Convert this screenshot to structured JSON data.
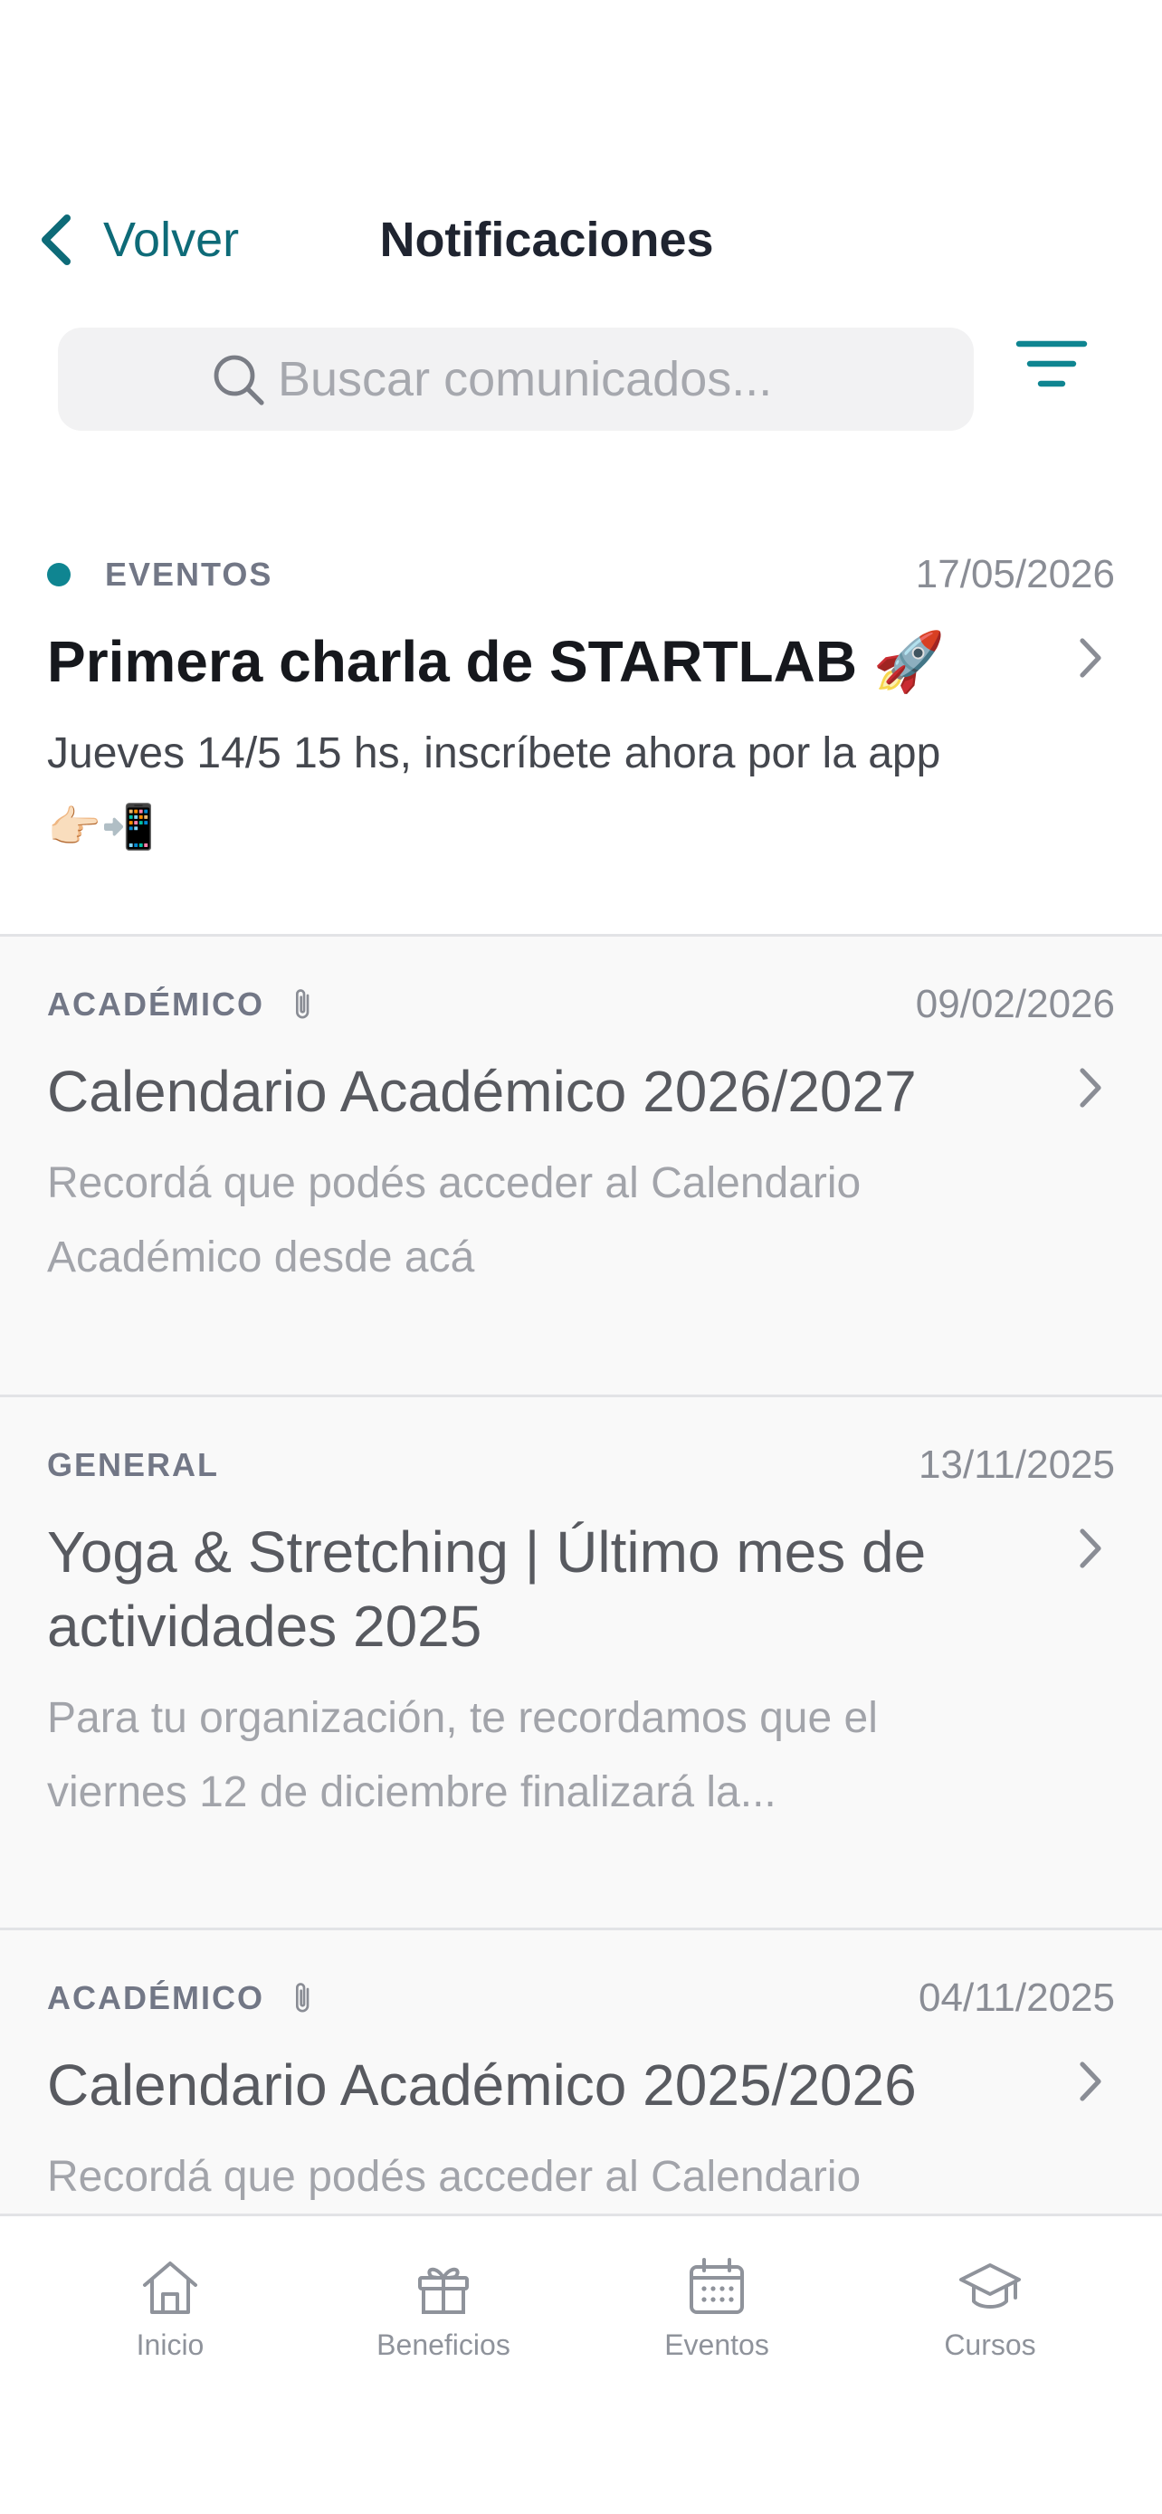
{
  "header": {
    "back_label": "Volver",
    "title": "Notificaciones"
  },
  "search": {
    "placeholder": "Buscar comunicados..."
  },
  "notifications": [
    {
      "category": "EVENTOS",
      "date": "17/05/2026",
      "title": "Primera charla de STARTLAB 🚀",
      "body": "Jueves 14/5 15 hs, inscríbete ahora por la app 👉🏻📲",
      "unread": true,
      "attachment": false
    },
    {
      "category": "ACADÉMICO",
      "date": "09/02/2026",
      "title": "Calendario Académico 2026/2027",
      "body": "Recordá que podés acceder al Calendario Académico desde acá",
      "unread": false,
      "attachment": true
    },
    {
      "category": "GENERAL",
      "date": "13/11/2025",
      "title": "Yoga & Stretching | Último mes de actividades 2025",
      "body": "Para tu organización, te recordamos que el viernes 12 de diciembre finalizará la...",
      "unread": false,
      "attachment": false
    },
    {
      "category": "ACADÉMICO",
      "date": "04/11/2025",
      "title": "Calendario Académico 2025/2026",
      "body": "Recordá que podés acceder al Calendario",
      "unread": false,
      "attachment": true
    }
  ],
  "nav": {
    "items": [
      {
        "label": "Inicio",
        "icon": "home-icon"
      },
      {
        "label": "Beneficios",
        "icon": "gift-icon"
      },
      {
        "label": "Eventos",
        "icon": "calendar-icon"
      },
      {
        "label": "Cursos",
        "icon": "graduation-cap-icon"
      }
    ]
  },
  "colors": {
    "accent": "#0e6b78",
    "unread_dot": "#0f8591",
    "muted_text": "#a2a4aa",
    "nav_gray": "#8f939b"
  }
}
